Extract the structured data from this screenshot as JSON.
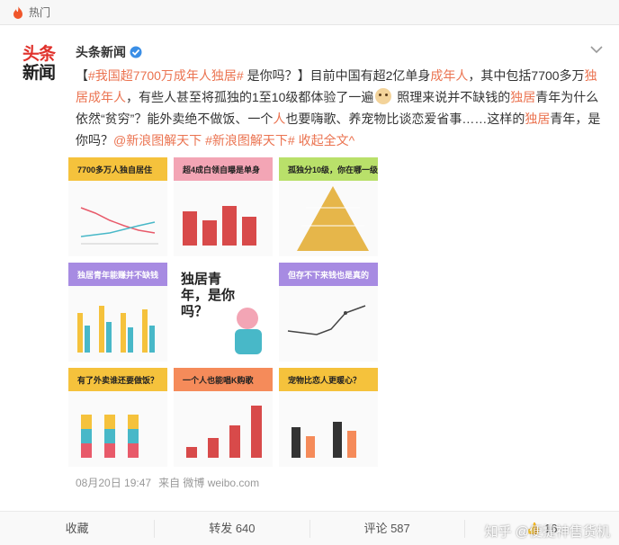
{
  "topbar": {
    "label": "热门",
    "icon": "fire-icon"
  },
  "post": {
    "author": "头条新闻",
    "avatar_line1": "头条",
    "avatar_line2": "新闻",
    "text_parts": {
      "bracket_open": "【",
      "hashtag": "#我国超7700万成年人独居#",
      "t1": " 是你吗？】目前中国有超2亿单身",
      "adults": "成年人",
      "t2": "，其中包括7700多万",
      "t2b": "独居成年人",
      "t3": "，有些人甚至将孤独的1至10级都体验了一遍",
      "t4": " 照理来说并不缺钱的",
      "solo": "独居",
      "t5": "青年为什么依然“贫穷”？能外卖绝不做饭、一个",
      "person": "人",
      "t6": "也要嗨歌、养宠物比谈恋爱省事……这样的",
      "solo2": "独居",
      "t7": "青年，是你吗？",
      "mention": "@新浪图解天下",
      "tag2": " #新浪图解天下#",
      "collapse": " 收起全文",
      "collapse_arrow": "^"
    },
    "meta": {
      "date": "08月20日 19:47",
      "source": "来自 微博 weibo.com"
    }
  },
  "tiles": [
    {
      "title": "7700多万人独自居住",
      "color": "#f5c23c"
    },
    {
      "title": "超4成白领自曝是单身",
      "color": "#f3a5b5"
    },
    {
      "title": "孤独分10级，你在哪一级",
      "color": "#b9e06a"
    },
    {
      "title": "独居青年能赚并不缺钱",
      "color": "#a78be2"
    },
    {
      "title": "独居青年，是你吗？",
      "color": "#ffffff"
    },
    {
      "title": "但存不下来钱也是真的",
      "color": "#a78be2"
    },
    {
      "title": "有了外卖谁还要做饭？",
      "color": "#f5c23c"
    },
    {
      "title": "一个人也能唱K购歌",
      "color": "#f58b5a"
    },
    {
      "title": "宠物比恋人更暖心？",
      "color": "#f5c23c"
    }
  ],
  "actions": {
    "collect": "收藏",
    "repost": "转发 640",
    "comment": "评论 587",
    "like": "16"
  },
  "watermark": "知乎 @便捷神售货机"
}
